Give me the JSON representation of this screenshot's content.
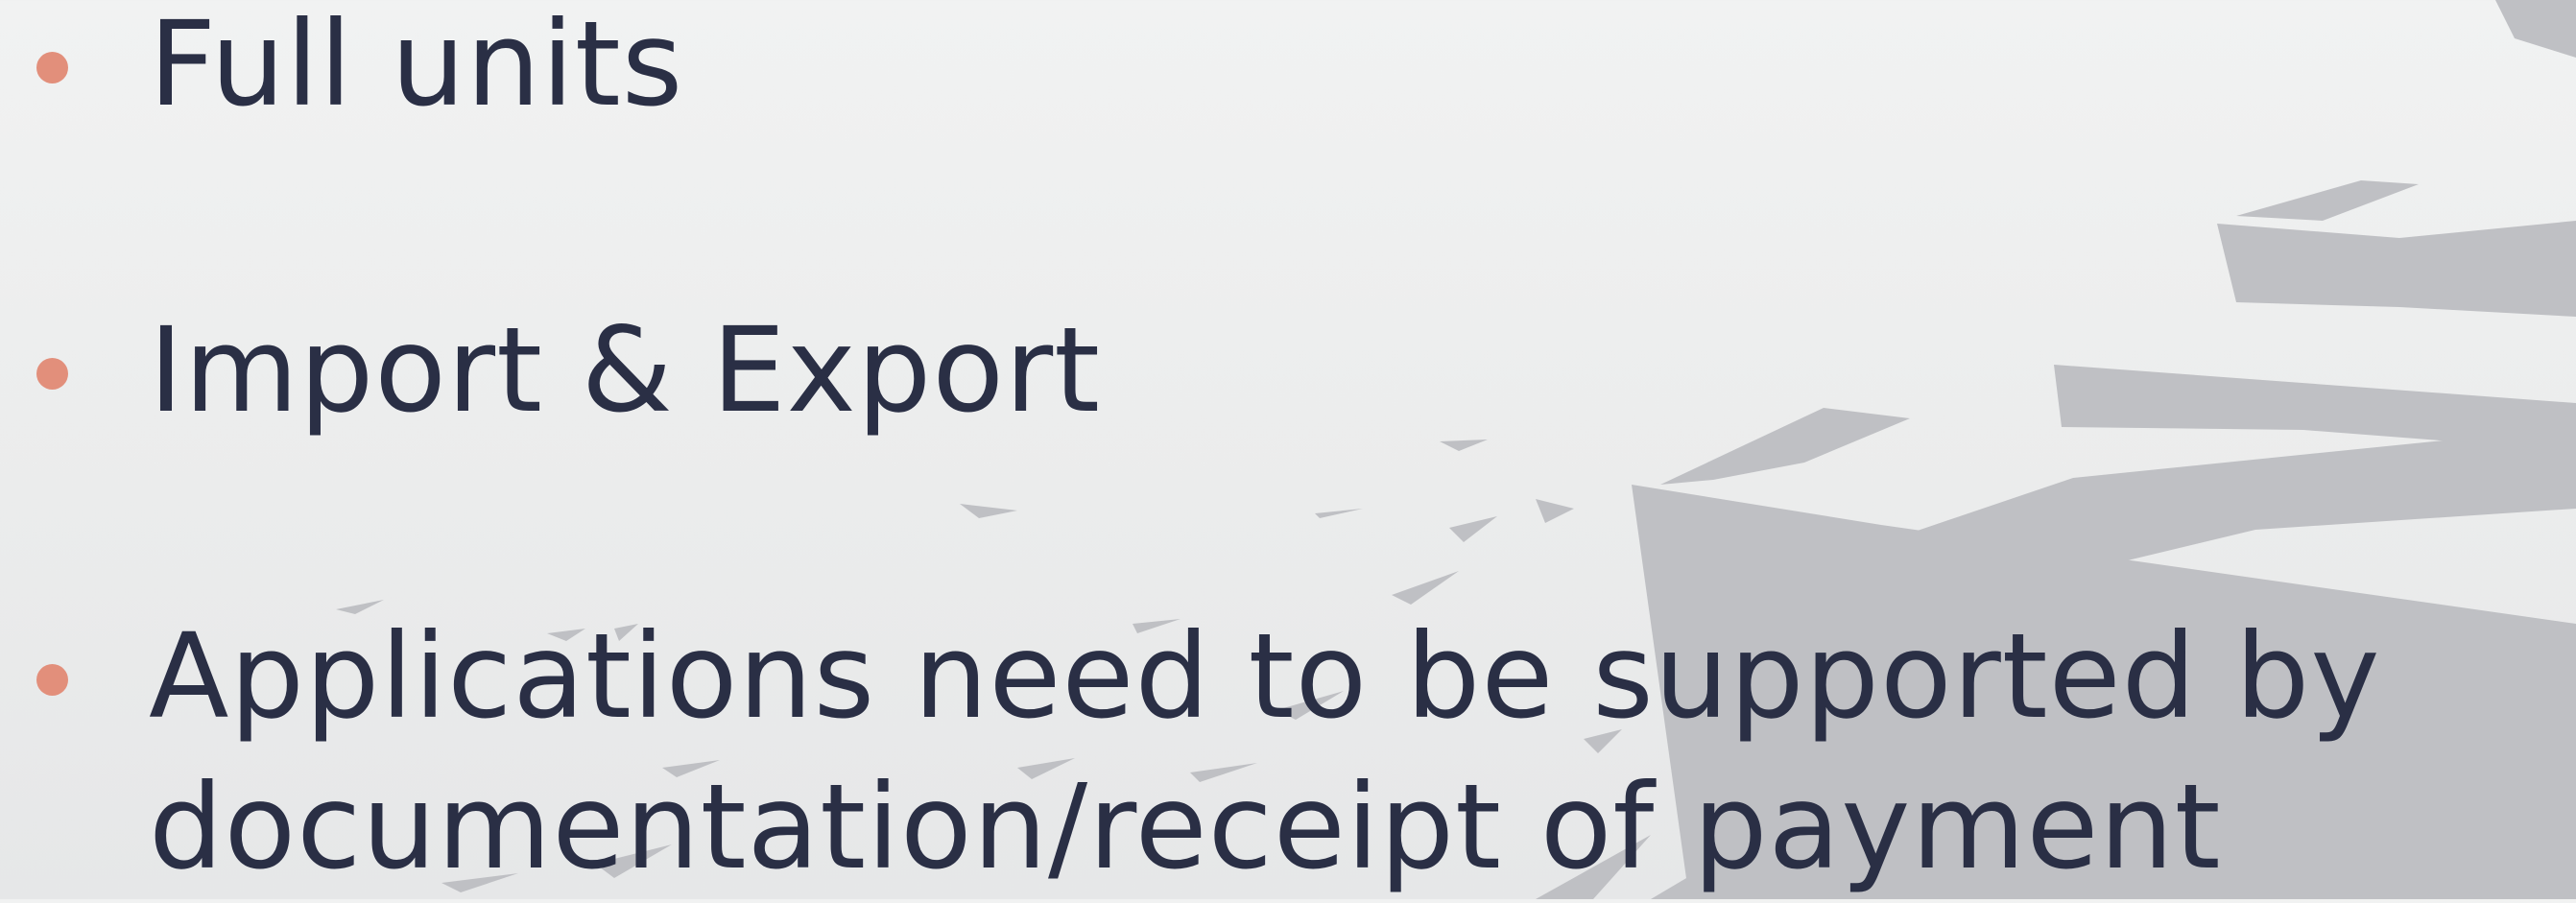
{
  "slide": {
    "accent_color": "#e28f7b",
    "text_color": "#2a2f45",
    "background_color": "#eeefef",
    "watermark_color": "#bfc0c4",
    "bullets": [
      {
        "text": "Full units"
      },
      {
        "text": "Import & Export"
      },
      {
        "text": "Applications need to be supported by"
      },
      {
        "text": "documentation/receipt of payment"
      }
    ]
  }
}
